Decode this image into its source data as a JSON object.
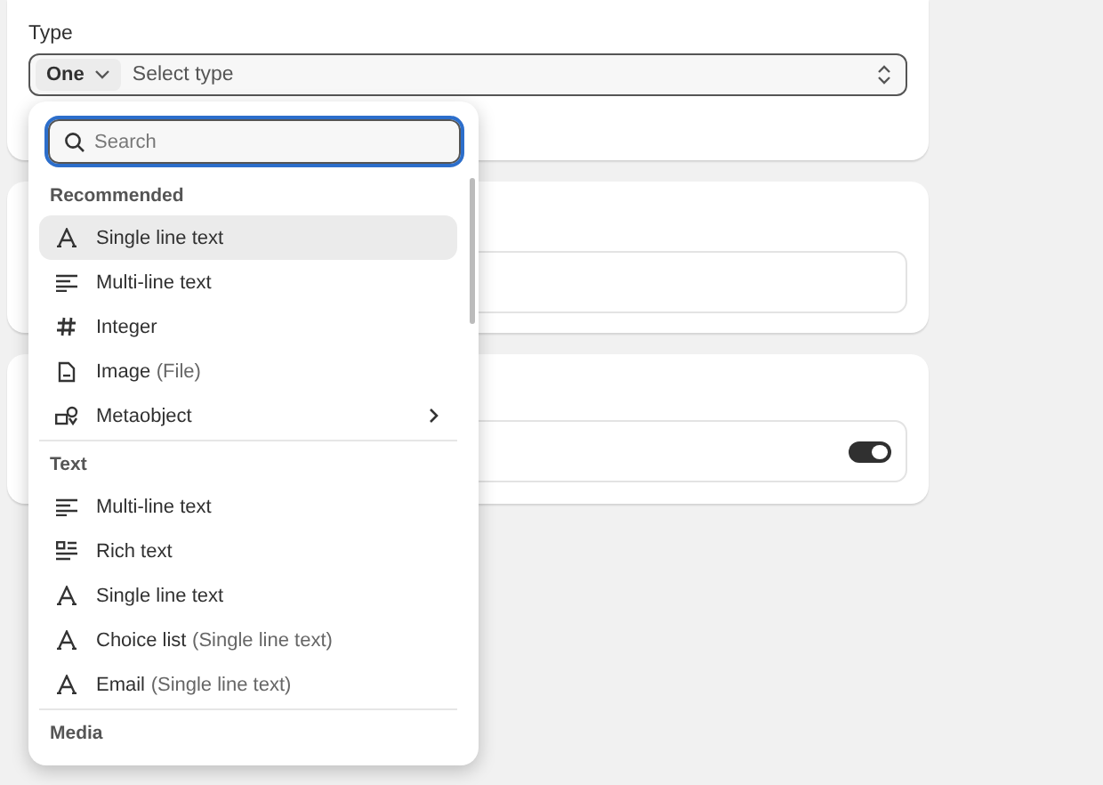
{
  "type_field": {
    "label": "Type",
    "prefix": "One",
    "placeholder": "Select type"
  },
  "menu": {
    "search": {
      "placeholder": "Search"
    },
    "sections": [
      {
        "heading": "Recommended",
        "items": [
          {
            "kind": "letter",
            "label": "Single line text",
            "selected": true,
            "submenu": false
          },
          {
            "kind": "lines",
            "label": "Multi-line text",
            "selected": false,
            "submenu": false
          },
          {
            "kind": "hash",
            "label": "Integer",
            "selected": false,
            "submenu": false
          },
          {
            "kind": "file",
            "label": "Image",
            "detail": "(File)",
            "selected": false,
            "submenu": false
          },
          {
            "kind": "metaobject",
            "label": "Metaobject",
            "selected": false,
            "submenu": true
          }
        ]
      },
      {
        "heading": "Text",
        "items": [
          {
            "kind": "lines",
            "label": "Multi-line text",
            "selected": false,
            "submenu": false
          },
          {
            "kind": "rich",
            "label": "Rich text",
            "selected": false,
            "submenu": false
          },
          {
            "kind": "letter",
            "label": "Single line text",
            "selected": false,
            "submenu": false
          },
          {
            "kind": "letter",
            "label": "Choice list",
            "detail": "(Single line text)",
            "selected": false,
            "submenu": false
          },
          {
            "kind": "letter",
            "label": "Email",
            "detail": "(Single line text)",
            "selected": false,
            "submenu": false
          }
        ]
      },
      {
        "heading": "Media"
      }
    ]
  },
  "toggle": {
    "on": true
  }
}
